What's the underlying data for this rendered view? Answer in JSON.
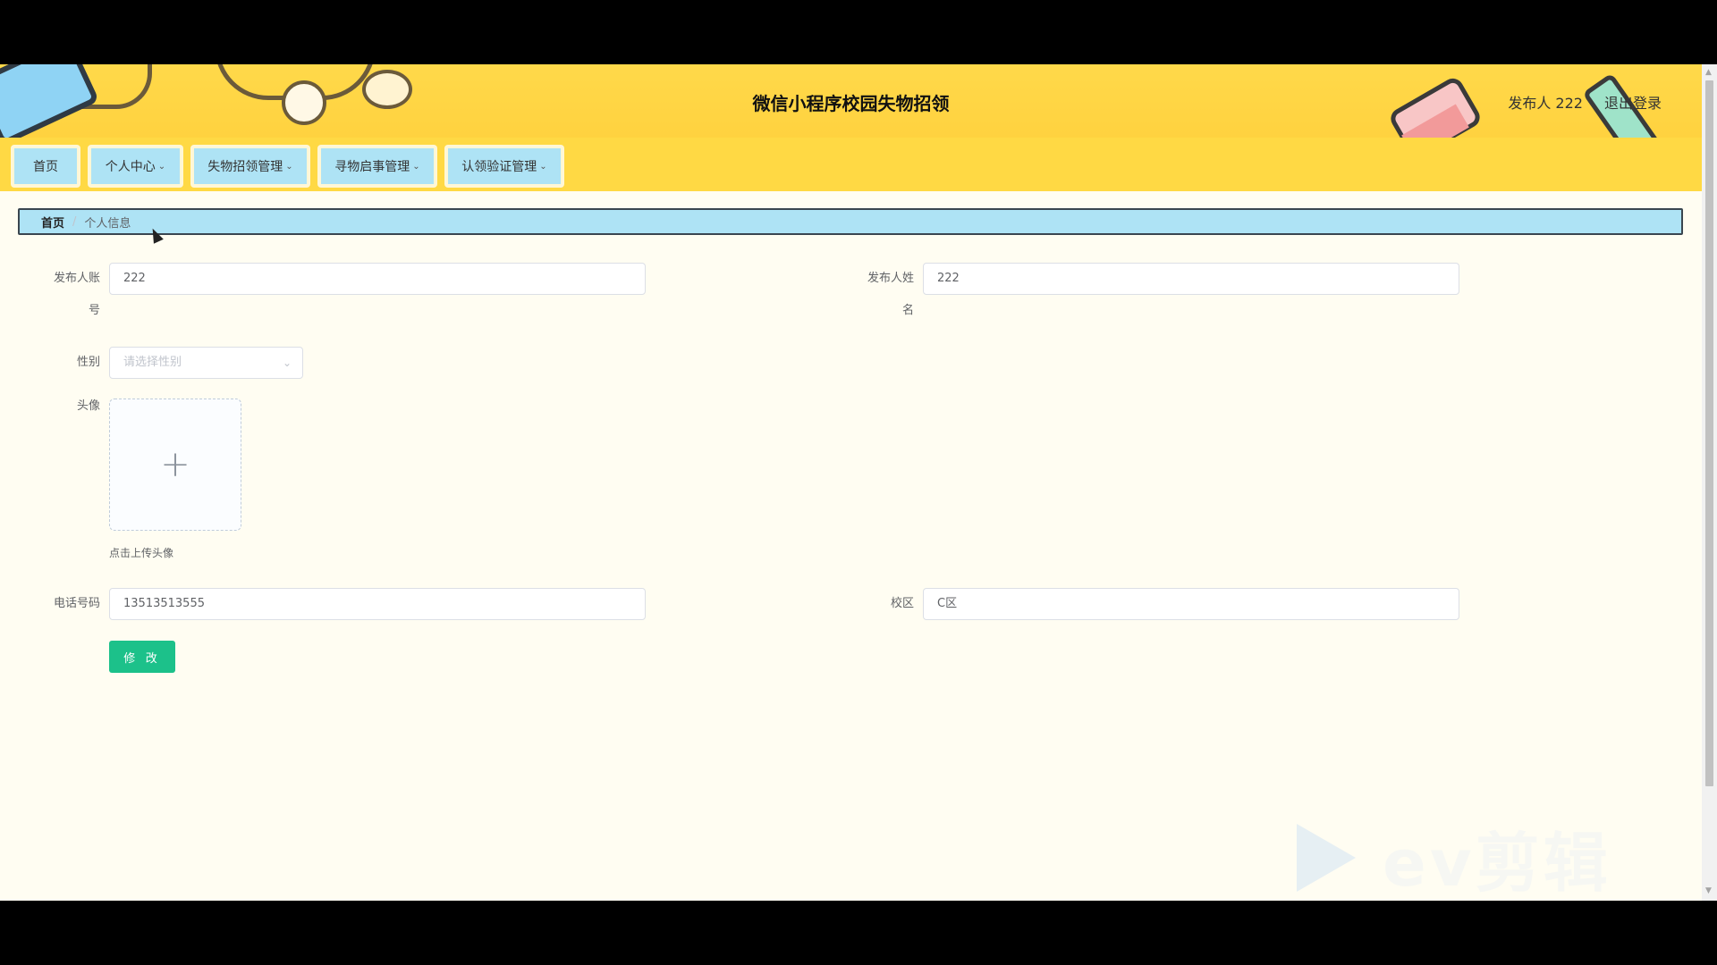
{
  "header": {
    "title": "微信小程序校园失物招领",
    "user_label": "发布人 222",
    "logout_label": "退出登录"
  },
  "nav": {
    "items": [
      {
        "label": "首页",
        "has_dropdown": false
      },
      {
        "label": "个人中心",
        "has_dropdown": true
      },
      {
        "label": "失物招领管理",
        "has_dropdown": true
      },
      {
        "label": "寻物启事管理",
        "has_dropdown": true
      },
      {
        "label": "认领验证管理",
        "has_dropdown": true
      }
    ]
  },
  "breadcrumb": {
    "home": "首页",
    "separator": "/",
    "current": "个人信息"
  },
  "form": {
    "account_label": "发布人账号",
    "account_label_line1": "发布人账",
    "account_label_line2": "号",
    "account_value": "222",
    "name_label_line1": "发布人姓",
    "name_label_line2": "名",
    "name_value": "222",
    "gender_label": "性别",
    "gender_placeholder": "请选择性别",
    "avatar_label": "头像",
    "avatar_tip": "点击上传头像",
    "phone_label": "电话号码",
    "phone_value": "13513513555",
    "campus_label": "校区",
    "campus_value": "C区",
    "submit_label": "修 改"
  },
  "watermark": {
    "text": "ev剪辑"
  },
  "colors": {
    "header_bg": "#ffd23f",
    "nav_item_bg": "#aee3f5",
    "page_bg": "#fffdf2",
    "primary_button": "#1cc18a"
  }
}
